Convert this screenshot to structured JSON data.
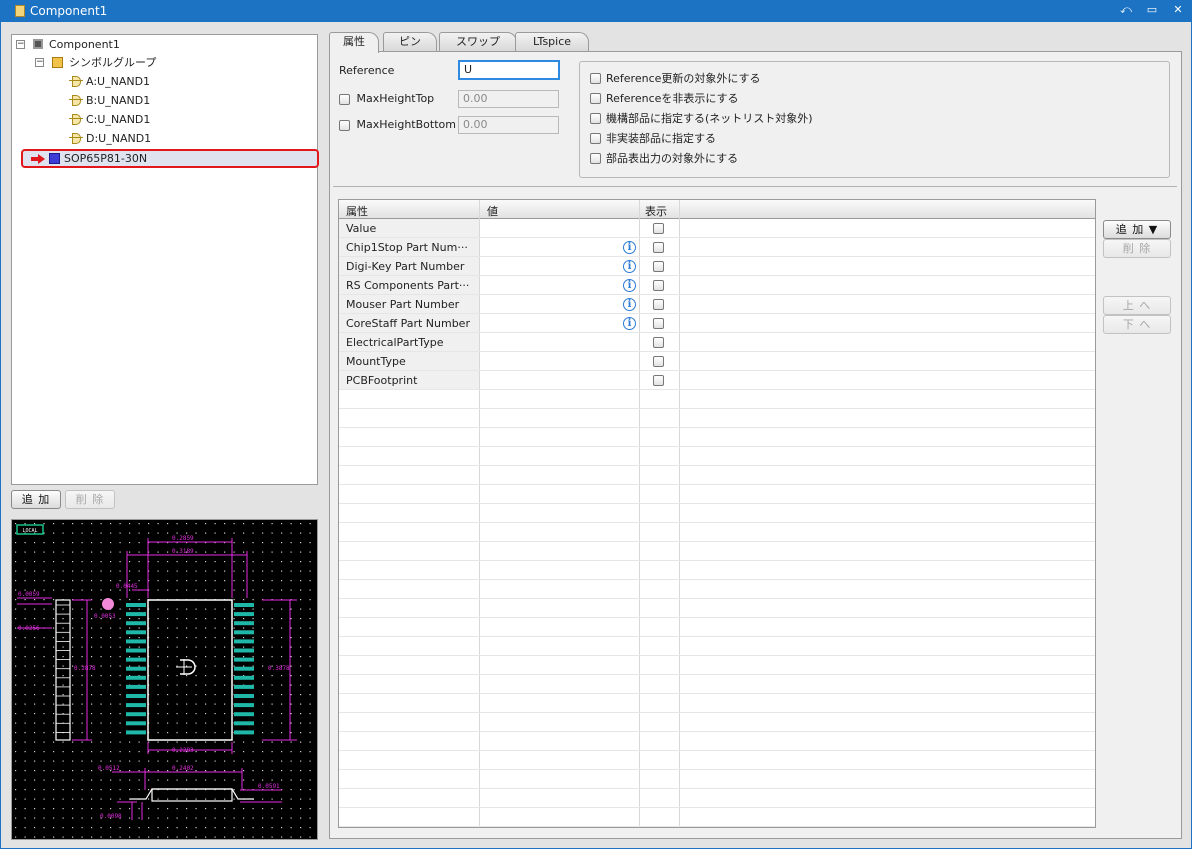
{
  "window": {
    "title": "Component1"
  },
  "tree": {
    "root": "Component1",
    "group": "シンボルグループ",
    "symbols": [
      "A:U_NAND1",
      "B:U_NAND1",
      "C:U_NAND1",
      "D:U_NAND1"
    ],
    "footprint": "SOP65P81-30N"
  },
  "left_buttons": {
    "add": "追 加",
    "delete": "削 除"
  },
  "preview": {
    "badge": "LOCAL",
    "dims": [
      "0.2859",
      "0.3189",
      "0.0445",
      "0.0059",
      "0.0256",
      "0.0053",
      "0.2878",
      "0.3878",
      "0.2283",
      "0.0512",
      "0.2402",
      "0.0591",
      "0.0098"
    ]
  },
  "tabs": [
    "属性",
    "ピン",
    "スワップ",
    "LTspice"
  ],
  "form": {
    "reference_label": "Reference",
    "reference_value": "U",
    "max_height_top_label": "MaxHeightTop",
    "max_height_top_value": "0.00",
    "max_height_bottom_label": "MaxHeightBottom",
    "max_height_bottom_value": "0.00"
  },
  "options": [
    "Reference更新の対象外にする",
    "Referenceを非表示にする",
    "機構部品に指定する(ネットリスト対象外)",
    "非実装部品に指定する",
    "部品表出力の対象外にする"
  ],
  "grid": {
    "headers": [
      "属性",
      "値",
      "表示"
    ],
    "rows": [
      {
        "name": "Value",
        "info": false
      },
      {
        "name": "Chip1Stop Part Num···",
        "info": true
      },
      {
        "name": "Digi-Key Part Number",
        "info": true
      },
      {
        "name": "RS Components Part···",
        "info": true
      },
      {
        "name": "Mouser Part Number",
        "info": true
      },
      {
        "name": "CoreStaff Part Number",
        "info": true
      },
      {
        "name": "ElectricalPartType",
        "info": false
      },
      {
        "name": "MountType",
        "info": false
      },
      {
        "name": "PCBFootprint",
        "info": false
      }
    ]
  },
  "right_buttons": {
    "add": "追 加 ▼",
    "delete": "削 除",
    "up": "上 へ",
    "down": "下 へ"
  }
}
